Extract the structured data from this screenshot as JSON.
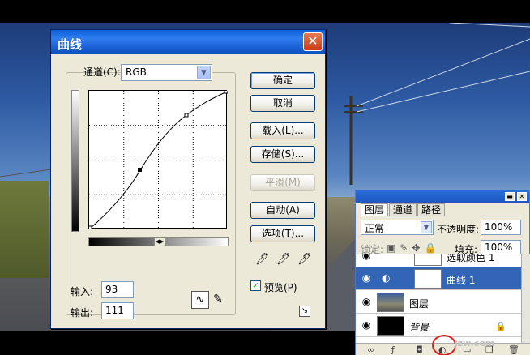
{
  "dialog": {
    "title": "曲线",
    "close_label": "✕",
    "channel_label": "通道(C):",
    "channel_value": "RGB",
    "input_label": "输入:",
    "input_value": "93",
    "output_label": "输出:",
    "output_value": "111",
    "buttons": {
      "ok": "确定",
      "cancel": "取消",
      "load": "载入(L)...",
      "save": "存储(S)...",
      "smooth": "平滑(M)",
      "auto": "自动(A)",
      "options": "选项(T)..."
    },
    "preview_label": "预览(P)",
    "preview_checked": true
  },
  "layers": {
    "tabs": [
      "图层",
      "通道",
      "路径"
    ],
    "blend_mode": "正常",
    "opacity_label": "不透明度:",
    "opacity_value": "100%",
    "lock_label": "锁定:",
    "fill_label": "填充:",
    "fill_value": "100%",
    "items": [
      {
        "name": "选取颜色 1"
      },
      {
        "name": "曲线 1"
      },
      {
        "name": "图层"
      },
      {
        "name": "背景"
      }
    ]
  },
  "watermark": "jzw.com"
}
